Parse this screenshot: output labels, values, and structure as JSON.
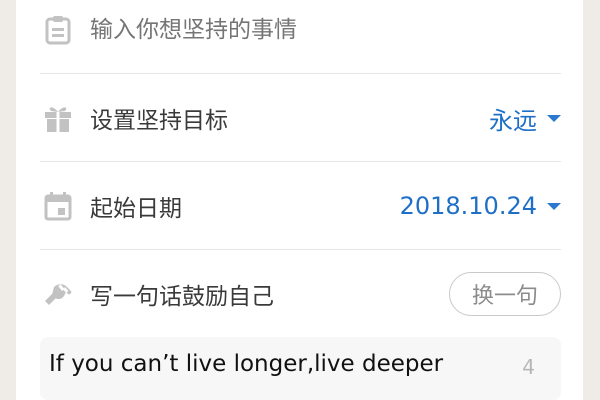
{
  "task_input": {
    "placeholder": "输入你想坚持的事情",
    "icon": "clipboard-icon"
  },
  "goal": {
    "label": "设置坚持目标",
    "value": "永远",
    "icon": "gift-icon"
  },
  "start_date": {
    "label": "起始日期",
    "value": "2018.10.24",
    "icon": "calendar-icon"
  },
  "motto": {
    "label": "写一句话鼓励自己",
    "change_button": "换一句",
    "icon": "hand-icon",
    "text": "If you can’t live longer,live deeper",
    "count": "4"
  },
  "colors": {
    "accent": "#1f6fc7",
    "icon_gray": "#bdbdbd",
    "background": "#efebe7"
  }
}
